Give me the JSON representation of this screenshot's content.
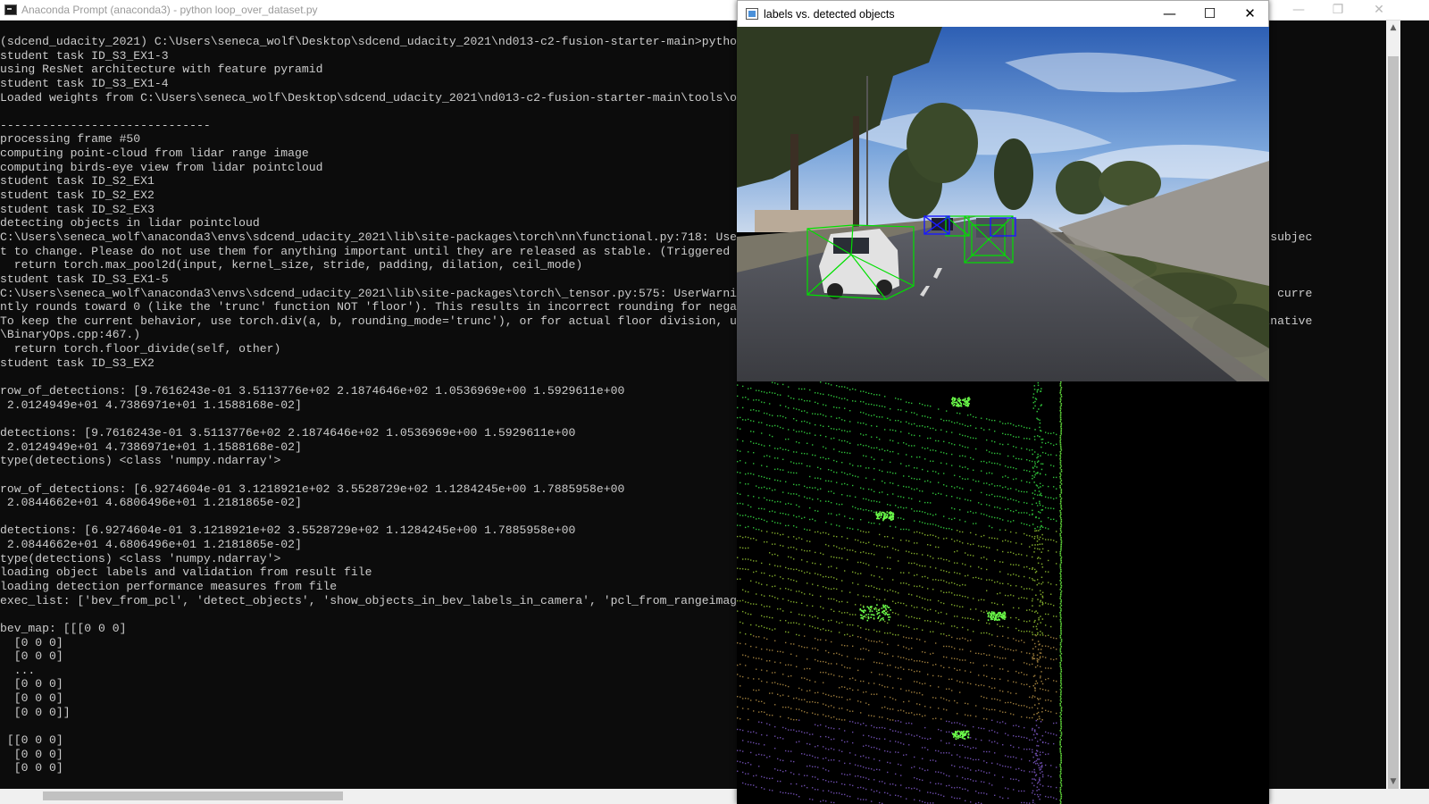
{
  "console": {
    "title": "Anaconda Prompt (anaconda3) - python  loop_over_dataset.py",
    "lines": [
      "(sdcend_udacity_2021) C:\\Users\\seneca_wolf\\Desktop\\sdcend_udacity_2021\\nd013-c2-fusion-starter-main>python loop_over_dataset.py",
      "student task ID_S3_EX1-3",
      "using ResNet architecture with feature pyramid",
      "student task ID_S3_EX1-4",
      "Loaded weights from C:\\Users\\seneca_wolf\\Desktop\\sdcend_udacity_2021\\nd013-c2-fusion-starter-main\\tools\\o",
      "",
      "------------------------------",
      "processing frame #50",
      "computing point-cloud from lidar range image",
      "computing birds-eye view from lidar pointcloud",
      "student task ID_S2_EX1",
      "student task ID_S2_EX2",
      "student task ID_S2_EX3",
      "detecting objects in lidar pointcloud",
      "C:\\Users\\seneca_wolf\\anaconda3\\envs\\sdcend_udacity_2021\\lib\\site-packages\\torch\\nn\\functional.py:718: Use                                                                  ature and subjec",
      "t to change. Please do not use them for anything important until they are released as stable. (Triggered",
      "  return torch.max_pool2d(input, kernel_size, stride, padding, dilation, ceil_mode)",
      "student task ID_S3_EX1-5",
      "C:\\Users\\seneca_wolf\\anaconda3\\envs\\sdcend_udacity_2021\\lib\\site-packages\\torch\\_tensor.py:575: UserWarni                                                                  ytorch. It curre",
      "ntly rounds toward 0 (like the 'trunc' function NOT 'floor'). This results in incorrect rounding for nega",
      "To keep the current behavior, use torch.div(a, b, rounding_mode='trunc'), or for actual floor division, u                                                                  \\src\\ATen\\native",
      "\\BinaryOps.cpp:467.)",
      "  return torch.floor_divide(self, other)",
      "student task ID_S3_EX2",
      "",
      "row_of_detections: [9.7616243e-01 3.5113776e+02 2.1874646e+02 1.0536969e+00 1.5929611e+00",
      " 2.0124949e+01 4.7386971e+01 1.1588168e-02]",
      "",
      "detections: [9.7616243e-01 3.5113776e+02 2.1874646e+02 1.0536969e+00 1.5929611e+00",
      " 2.0124949e+01 4.7386971e+01 1.1588168e-02]",
      "type(detections) <class 'numpy.ndarray'>",
      "",
      "row_of_detections: [6.9274604e-01 3.1218921e+02 3.5528729e+02 1.1284245e+00 1.7885958e+00",
      " 2.0844662e+01 4.6806496e+01 1.2181865e-02]",
      "",
      "detections: [6.9274604e-01 3.1218921e+02 3.5528729e+02 1.1284245e+00 1.7885958e+00",
      " 2.0844662e+01 4.6806496e+01 1.2181865e-02]",
      "type(detections) <class 'numpy.ndarray'>",
      "loading object labels and validation from result file",
      "loading detection performance measures from file",
      "exec_list: ['bev_from_pcl', 'detect_objects', 'show_objects_in_bev_labels_in_camera', 'pcl_from_rangeimag",
      "",
      "bev_map: [[[0 0 0]",
      "  [0 0 0]",
      "  [0 0 0]",
      "  ...",
      "  [0 0 0]",
      "  [0 0 0]",
      "  [0 0 0]]",
      "",
      " [[0 0 0]",
      "  [0 0 0]",
      "  [0 0 0]"
    ],
    "controls": {
      "minimize": "—",
      "restore": "❐",
      "close": "✕"
    }
  },
  "image_window": {
    "title": "labels vs. detected objects",
    "controls": {
      "minimize": "—",
      "maximize": "☐",
      "close": "✕"
    },
    "label_color": "#00e000",
    "detection_color": "#1a1aff",
    "icon_names": [
      "window-icon",
      "minimize-icon",
      "maximize-icon",
      "close-icon"
    ]
  }
}
